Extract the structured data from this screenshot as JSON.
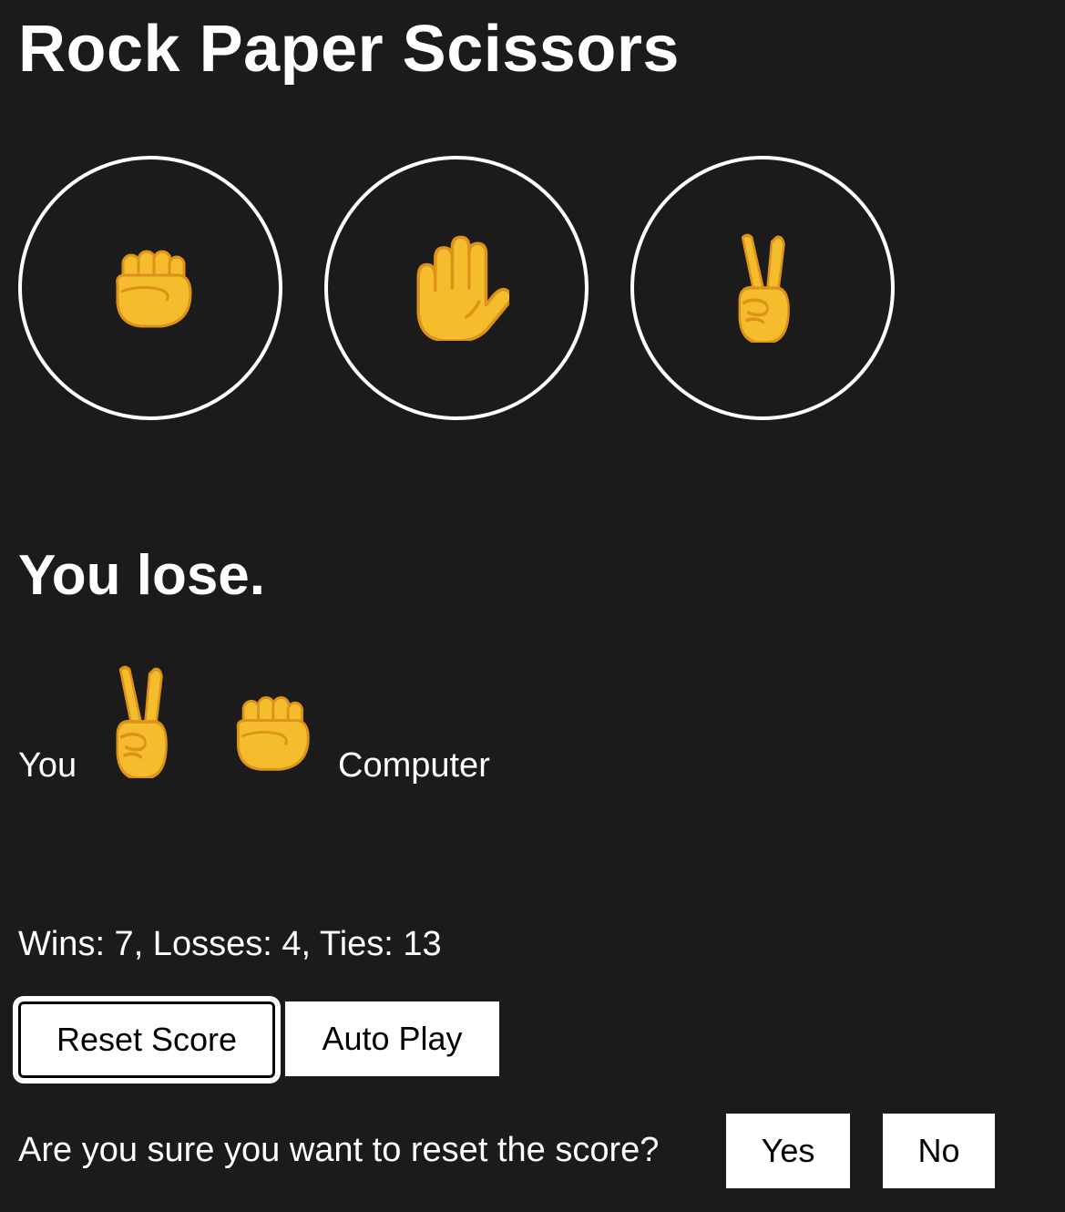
{
  "app": {
    "title": "Rock Paper Scissors"
  },
  "moves": [
    {
      "name": "rock",
      "icon": "raised-fist-icon"
    },
    {
      "name": "paper",
      "icon": "raised-hand-icon"
    },
    {
      "name": "scissors",
      "icon": "victory-hand-icon"
    }
  ],
  "result": {
    "text": "You lose."
  },
  "last_round": {
    "you_label": "You",
    "you_move_icon": "victory-hand-icon",
    "computer_move_icon": "raised-fist-icon",
    "computer_label": "Computer"
  },
  "score": {
    "text": "Wins: 7, Losses: 4, Ties: 13"
  },
  "controls": {
    "reset_label": "Reset Score",
    "auto_play_label": "Auto Play"
  },
  "confirm": {
    "question": "Are you sure you want to reset the score?",
    "yes_label": "Yes",
    "no_label": "No"
  },
  "colors": {
    "background": "#1b1b1b",
    "text": "#ffffff",
    "emoji_skin": "#f5bd2e",
    "emoji_outline": "#dd9318"
  }
}
